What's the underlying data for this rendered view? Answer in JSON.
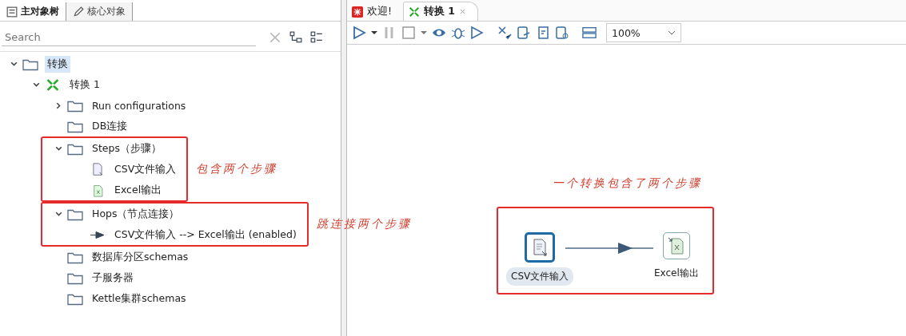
{
  "left_tabs": [
    {
      "label": "主对象树",
      "selected": true
    },
    {
      "label": "核心对象",
      "selected": false
    }
  ],
  "search": {
    "placeholder": "Search"
  },
  "tree": [
    {
      "label": "转换",
      "kind": "folder",
      "expanded": true,
      "selected": true,
      "children": [
        {
          "label": "转换 1",
          "kind": "trans",
          "expanded": true,
          "selected": false,
          "children": [
            {
              "label": "Run configurations",
              "kind": "folder",
              "expanded": false,
              "selected": false
            },
            {
              "label": "DB连接",
              "kind": "folder",
              "selected": false
            },
            {
              "label": "Steps（步骤）",
              "kind": "folder",
              "expanded": true,
              "selected": false,
              "note": "包含两个步骤",
              "children": [
                {
                  "label": "CSV文件输入",
                  "kind": "input",
                  "selected": false
                },
                {
                  "label": "Excel输出",
                  "kind": "output",
                  "selected": false
                }
              ]
            },
            {
              "label": "Hops（节点连接）",
              "kind": "folder",
              "expanded": true,
              "selected": false,
              "note": "跳连接两个步骤",
              "children": [
                {
                  "label": "CSV文件输入 --> Excel输出 (enabled)",
                  "kind": "hop",
                  "selected": false
                }
              ]
            },
            {
              "label": "数据库分区schemas",
              "kind": "folder",
              "selected": false
            },
            {
              "label": "子服务器",
              "kind": "folder",
              "selected": false
            },
            {
              "label": "Kettle集群schemas",
              "kind": "folder",
              "selected": false
            }
          ]
        }
      ]
    }
  ],
  "editor_tabs": [
    {
      "label": "欢迎!",
      "kind": "welcome",
      "selected": false
    },
    {
      "label": "转换 1",
      "kind": "trans",
      "selected": true,
      "closable": true
    }
  ],
  "zoom": {
    "value": "100%"
  },
  "canvas": {
    "note": "一个转换包含了两个步骤",
    "steps": [
      {
        "label": "CSV文件输入",
        "kind": "input",
        "selected": true
      },
      {
        "label": "Excel输出",
        "kind": "output",
        "selected": false
      }
    ]
  }
}
